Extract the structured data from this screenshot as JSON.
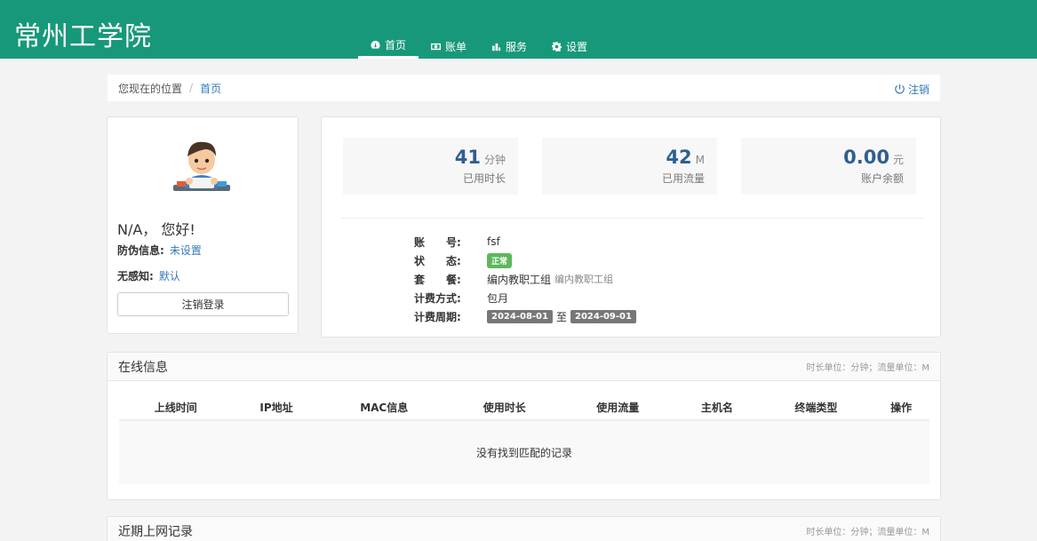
{
  "header": {
    "brand": "常州工学院",
    "nav": [
      {
        "label": "首页",
        "icon": "dashboard-icon"
      },
      {
        "label": "账单",
        "icon": "bill-icon"
      },
      {
        "label": "服务",
        "icon": "service-icon"
      },
      {
        "label": "设置",
        "icon": "gear-icon"
      }
    ]
  },
  "breadcrumb": {
    "here": "您现在的位置",
    "sep": "/",
    "home": "首页",
    "logout": "注销"
  },
  "profile": {
    "greeting": "N/A， 您好!",
    "anti_fake_label": "防伪信息:",
    "anti_fake_value": "未设置",
    "no_sense_label": "无感知:",
    "no_sense_value": "默认",
    "logout_button": "注销登录"
  },
  "stats": [
    {
      "value": "41",
      "unit": "分钟",
      "label": "已用时长"
    },
    {
      "value": "42",
      "unit": "M",
      "label": "已用流量"
    },
    {
      "value": "0.00",
      "unit": "元",
      "label": "账户余额"
    }
  ],
  "details": {
    "account_label": "账　　号:",
    "account_value": "fsf",
    "status_label": "状　　态:",
    "status_value": "正常",
    "package_label": "套　　餐:",
    "package_value": "编内教职工组",
    "package_sub": "编内教职工组",
    "billing_label": "计费方式:",
    "billing_value": "包月",
    "period_label": "计费周期:",
    "period_start": "2024-08-01",
    "period_to": "至",
    "period_end": "2024-09-01"
  },
  "online": {
    "title": "在线信息",
    "units": "时长单位：分钟；流量单位：M",
    "columns": [
      "上线时间",
      "IP地址",
      "MAC信息",
      "使用时长",
      "使用流量",
      "主机名",
      "终端类型",
      "操作"
    ],
    "empty": "没有找到匹配的记录"
  },
  "recent": {
    "title": "近期上网记录",
    "units": "时长单位：分钟；流量单位：M"
  },
  "colors": {
    "primary": "#18987a",
    "link": "#337ab7",
    "success": "#5cb85c"
  }
}
